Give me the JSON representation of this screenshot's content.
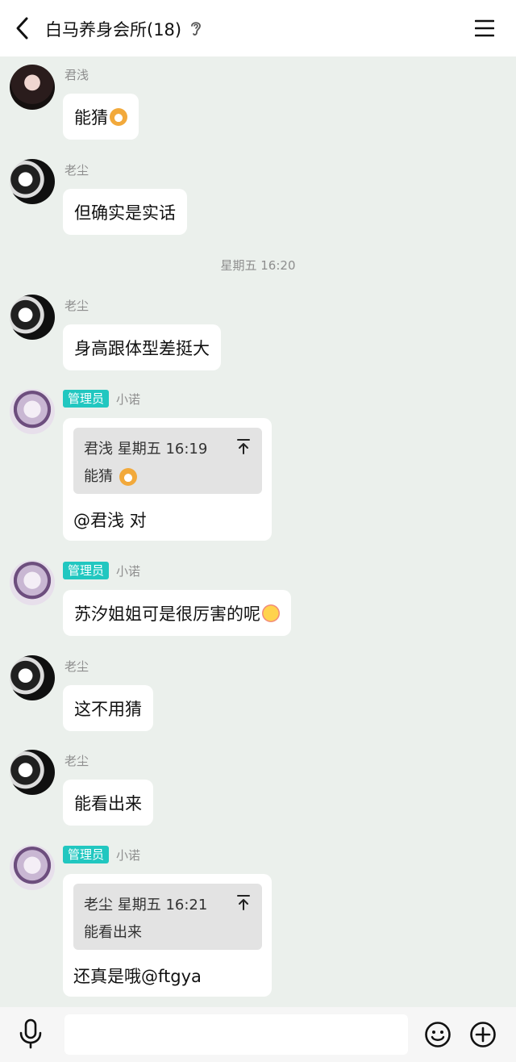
{
  "header": {
    "title": "白马养身会所(18)"
  },
  "messages": [
    {
      "sender": "君浅",
      "text": "能猜",
      "emoji": "dog-face-emoji"
    },
    {
      "sender": "老尘",
      "text": "但确实是实话"
    },
    {
      "time": "星期五 16:20"
    },
    {
      "sender": "老尘",
      "text": "身高跟体型差挺大"
    },
    {
      "role": "管理员",
      "sender": "小诺",
      "quote": {
        "header": "君浅 星期五 16:19",
        "text": "能猜",
        "emoji": "dog-face-emoji"
      },
      "text": "@君浅 对"
    },
    {
      "role": "管理员",
      "sender": "小诺",
      "text": "苏汐姐姐可是很厉害的呢",
      "emoji": "hugging-face-emoji"
    },
    {
      "sender": "老尘",
      "text": "这不用猜"
    },
    {
      "sender": "老尘",
      "text": "能看出来"
    },
    {
      "role": "管理员",
      "sender": "小诺",
      "quote": {
        "header": "老尘 星期五 16:21",
        "text": "能看出来"
      },
      "text": "还真是哦@ftgya"
    }
  ],
  "colors": {
    "badge": "#21C7C0",
    "chat_background": "#EBF0EC",
    "bubble": "#FFFFFF",
    "quote_background": "#E3E3E3"
  }
}
